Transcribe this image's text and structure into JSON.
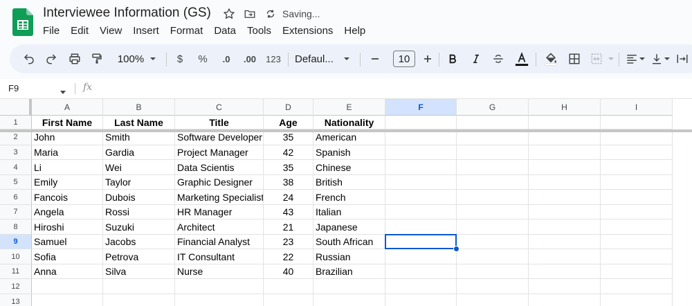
{
  "doc": {
    "title": "Interviewee Information (GS)",
    "status": "Saving..."
  },
  "menu": [
    "File",
    "Edit",
    "View",
    "Insert",
    "Format",
    "Data",
    "Tools",
    "Extensions",
    "Help"
  ],
  "toolbar": {
    "zoom": "100%",
    "currency": "$",
    "percent": "%",
    "decrease_decimal": ".0",
    "increase_decimal": ".00",
    "number_format": "123",
    "font": "Defaul...",
    "font_size": "10"
  },
  "namebox": "F9",
  "columns": [
    "A",
    "B",
    "C",
    "D",
    "E",
    "F",
    "G",
    "H",
    "I"
  ],
  "selected_column": "F",
  "selected_row": "9",
  "rows": [
    "1",
    "2",
    "3",
    "4",
    "5",
    "6",
    "7",
    "8",
    "9",
    "10",
    "11",
    "12",
    "13"
  ],
  "headers": [
    "First Name",
    "Last Name",
    "Title",
    "Age",
    "Nationality"
  ],
  "data": [
    [
      "John",
      "Smith",
      "Software Developer",
      "35",
      "American"
    ],
    [
      "Maria",
      "Gardia",
      "Project Manager",
      "42",
      "Spanish"
    ],
    [
      "Li",
      "Wei",
      "Data Scientis",
      "35",
      "Chinese"
    ],
    [
      "Emily",
      "Taylor",
      "Graphic Designer",
      "38",
      "British"
    ],
    [
      "Fancois",
      "Dubois",
      "Marketing Specialist",
      "24",
      "French"
    ],
    [
      "Angela",
      "Rossi",
      "HR Manager",
      "43",
      "Italian"
    ],
    [
      "Hiroshi",
      "Suzuki",
      "Architect",
      "21",
      "Japanese"
    ],
    [
      "Samuel",
      "Jacobs",
      "Financial Analyst",
      "23",
      "South African"
    ],
    [
      "Sofia",
      "Petrova",
      "IT Consultant",
      "22",
      "Russian"
    ],
    [
      "Anna",
      "Silva",
      "Nurse",
      "40",
      "Brazilian"
    ]
  ],
  "colors": {
    "accent": "#0b57d0",
    "sheets_green": "#0f9d58"
  }
}
